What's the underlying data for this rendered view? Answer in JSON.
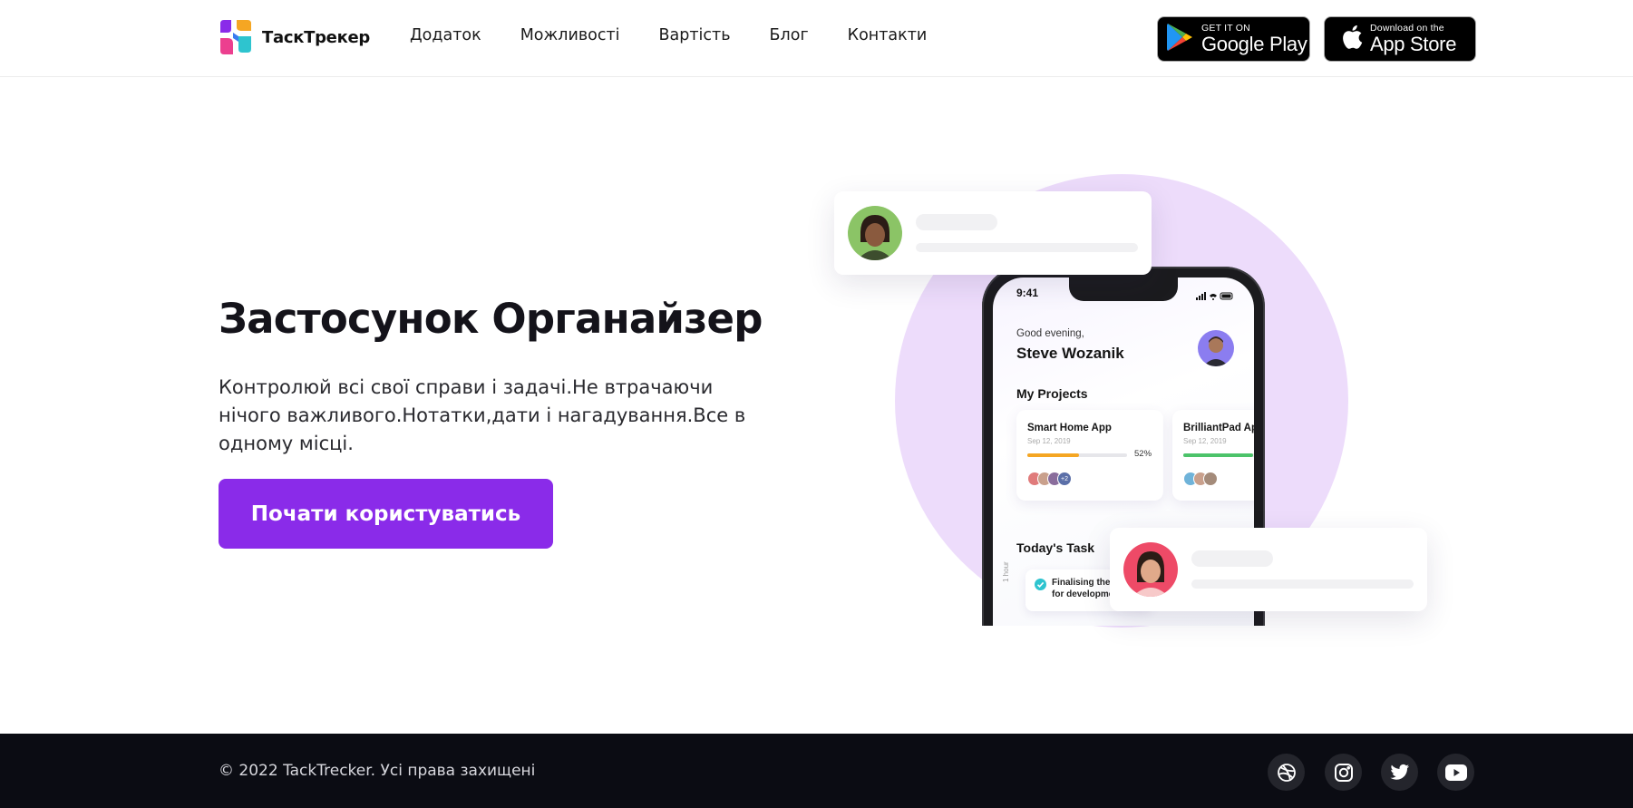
{
  "header": {
    "logo_text": "ТаскТрекер",
    "nav": [
      "Додаток",
      "Можливості",
      "Вартість",
      "Блог",
      "Контакти"
    ],
    "google_play": {
      "small": "GET IT ON",
      "big": "Google Play"
    },
    "app_store": {
      "small": "Download on the",
      "big": "App Store"
    }
  },
  "hero": {
    "title": "Застосунок Органайзер",
    "description": "Контролюй всі свої справи і задачі.Не втрачаючи нічого важливого.Нотатки,дати і нагадування.Все в одному місці.",
    "cta_label": "Почати користуватись"
  },
  "phone": {
    "time": "9:41",
    "greeting": "Good evening,",
    "user_name": "Steve Wozanik",
    "projects_title": "My Projects",
    "projects": [
      {
        "name": "Smart Home App",
        "date": "Sep 12, 2019",
        "progress": 52,
        "progress_label": "52%",
        "extra_members": "+2",
        "color": "#f5a623"
      },
      {
        "name": "BrilliantPad App",
        "date": "Sep 12, 2019",
        "progress": 70,
        "progress_label": "",
        "extra_members": "",
        "color": "#4cc36a"
      }
    ],
    "tasks_title": "Today's Task",
    "task_hour": "1 hour",
    "task_text": "Finalising the Web App for development"
  },
  "footer": {
    "copyright": "© 2022 TackTrecker. Усі права захищені",
    "social": [
      "dribbble-icon",
      "instagram-icon",
      "twitter-icon",
      "youtube-icon"
    ]
  },
  "colors": {
    "accent": "#8a2be9",
    "blob": "#eddcfb",
    "footer_bg": "#0b0c13"
  }
}
